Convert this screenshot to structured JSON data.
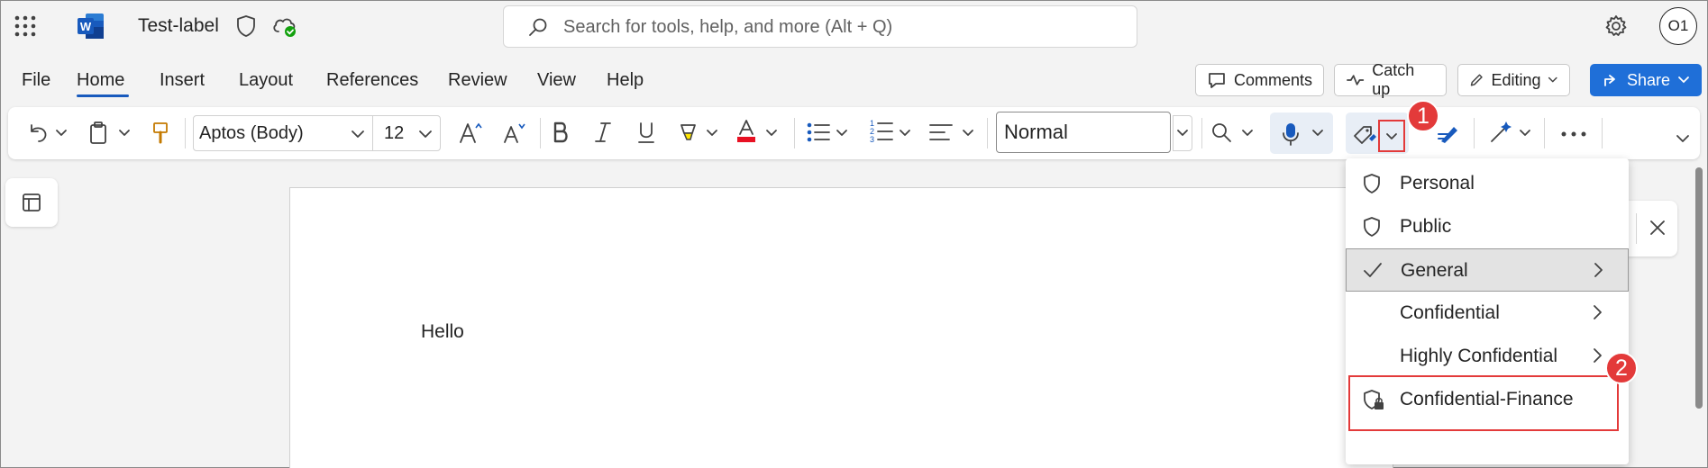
{
  "titlebar": {
    "doc_title": "Test-label",
    "search_placeholder": "Search for tools, help, and more (Alt + Q)",
    "avatar_initials": "O1"
  },
  "menu_tabs": [
    "File",
    "Home",
    "Insert",
    "Layout",
    "References",
    "Review",
    "View",
    "Help"
  ],
  "top_buttons": {
    "comments": "Comments",
    "catchup": "Catch up",
    "editing": "Editing",
    "share": "Share"
  },
  "ribbon": {
    "font_name": "Aptos (Body)",
    "font_size": "12",
    "style": "Normal"
  },
  "document": {
    "text": "Hello"
  },
  "sensitivity_menu": {
    "items": [
      {
        "label": "Personal",
        "icon": "shield-icon"
      },
      {
        "label": "Public",
        "icon": "shield-icon"
      },
      {
        "label": "General",
        "icon": "checkmark-icon",
        "checked": true,
        "submenu": true
      },
      {
        "label": "Confidential",
        "submenu": true
      },
      {
        "label": "Highly Confidential",
        "submenu": true
      },
      {
        "label": "Confidential-Finance",
        "icon": "shield-lock-icon"
      }
    ]
  },
  "annotations": {
    "step1": "1",
    "step2": "2"
  },
  "colors": {
    "accent": "#185abd",
    "share": "#1f6fd8",
    "callout": "#e33a3a"
  }
}
